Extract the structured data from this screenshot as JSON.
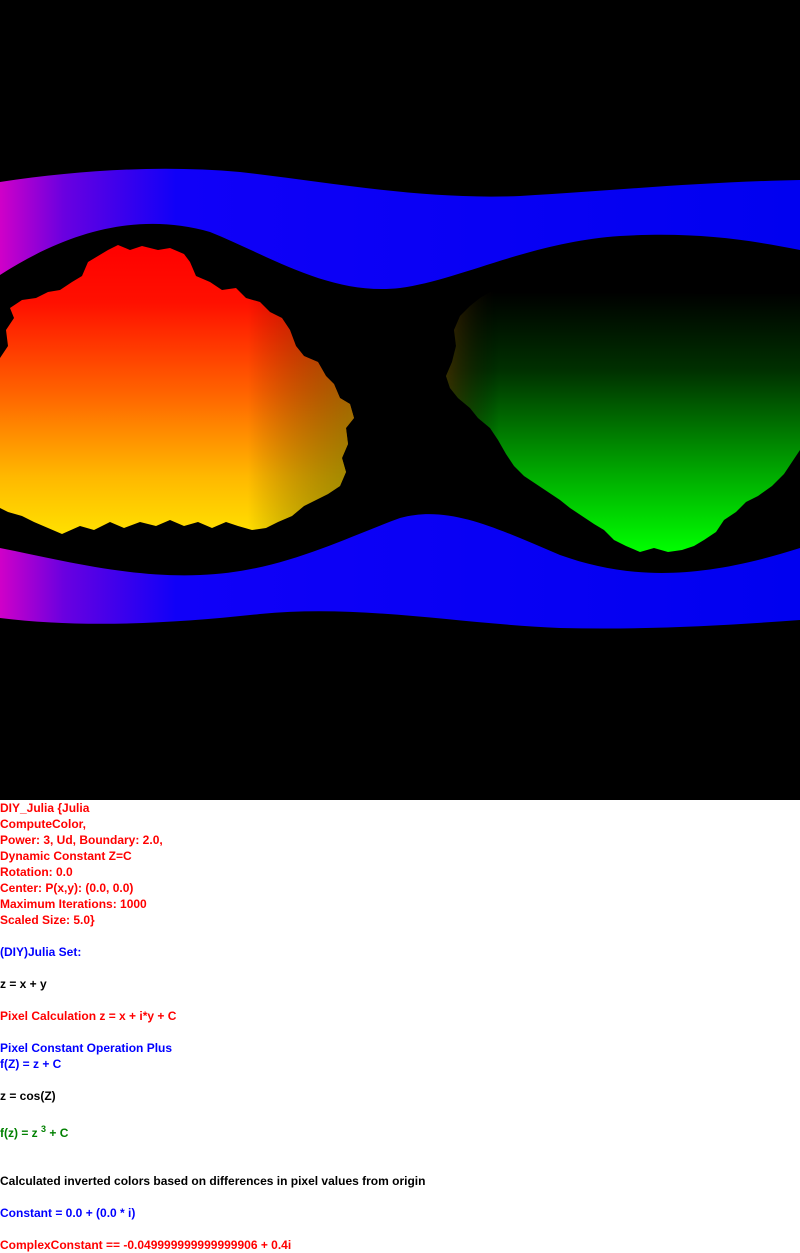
{
  "render": {
    "colors": {
      "background": "#000000",
      "band": "#0000ff",
      "band_edge": "#cc00cc",
      "left_blob_top": "#ff0000",
      "left_blob_bottom": "#ffd700",
      "right_blob_top": "#000000",
      "right_blob_bottom": "#00ff00"
    }
  },
  "info": {
    "params": [
      "DIY_Julia {Julia",
      "ComputeColor,",
      "Power: 3, Ud, Boundary: 2.0,",
      "Dynamic Constant Z=C",
      "Rotation: 0.0",
      "Center: P(x,y): (0.0, 0.0)",
      "Maximum Iterations: 1000",
      "Scaled Size: 5.0}"
    ],
    "set_title": "(DIY)Julia Set:",
    "z_def": "z = x + y",
    "pixel_calc": "Pixel Calculation z = x + i*y + C",
    "const_op": "Pixel Constant Operation Plus",
    "fz_plus": "f(Z) = z + C",
    "z_cos": "z = cos(Z)",
    "formula": {
      "prefix": "f(z) = z ",
      "exponent": "3",
      "suffix": " + C"
    },
    "color_note": "Calculated inverted colors based on differences in pixel values from origin",
    "constant": "Constant = 0.0 + (0.0 * i)",
    "complex_constant": "ComplexConstant == -0.049999999999999906 + 0.4i"
  }
}
